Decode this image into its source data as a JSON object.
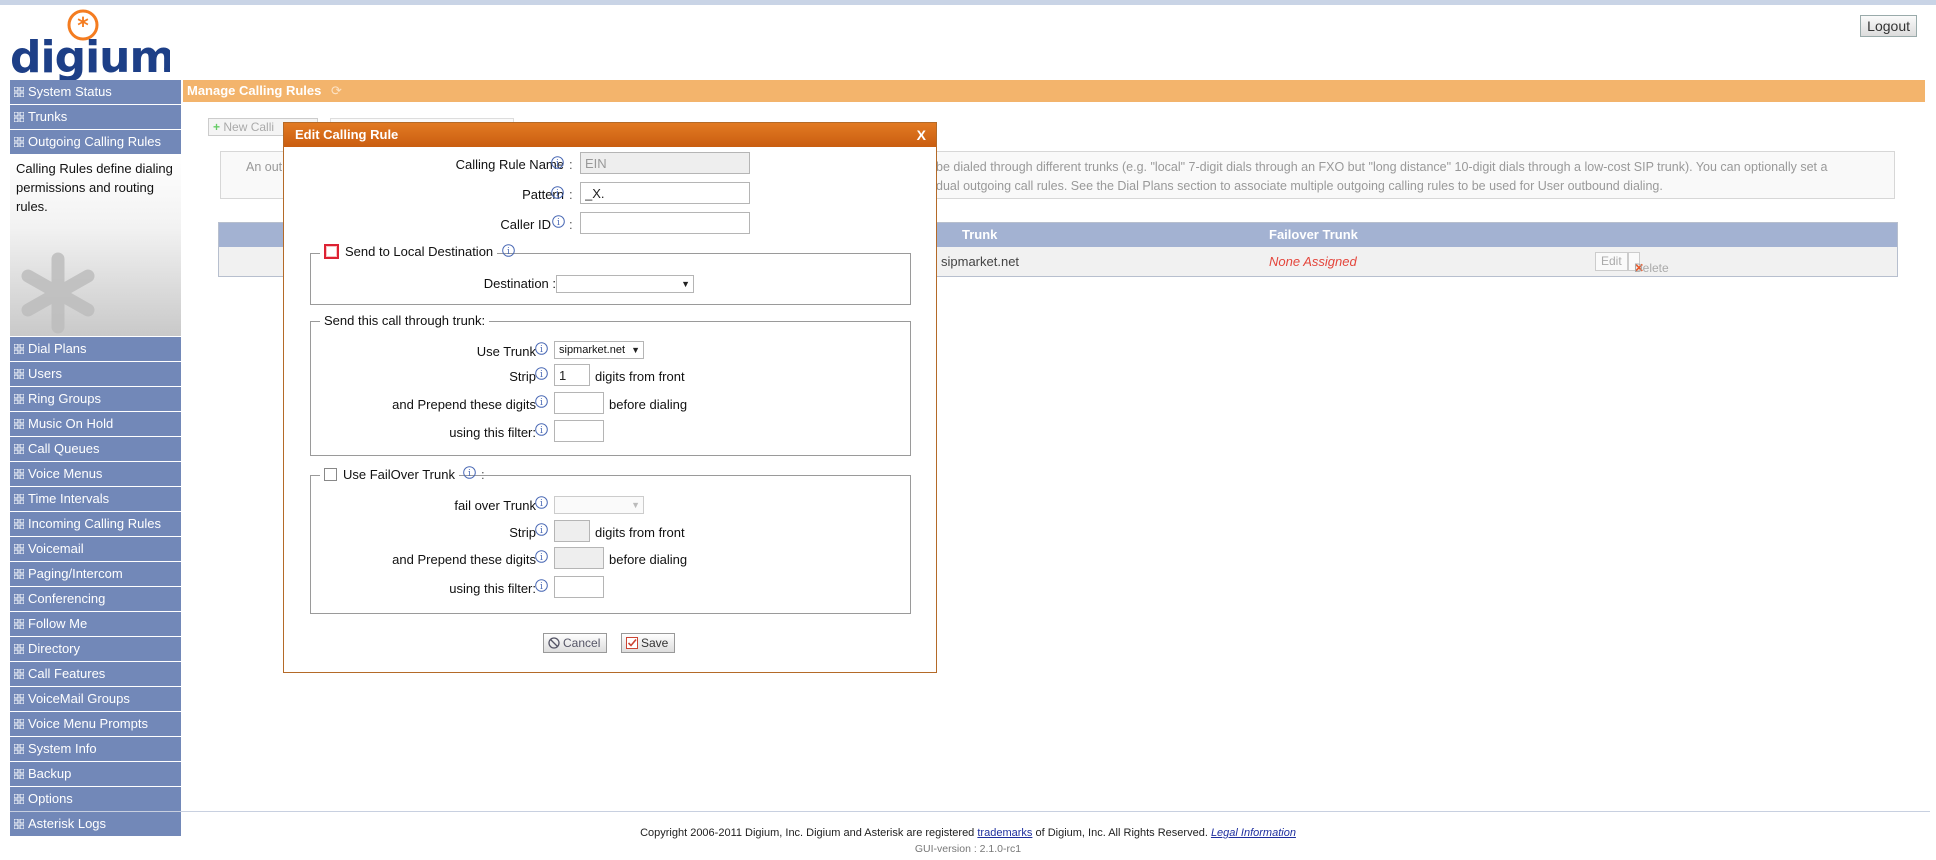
{
  "app": {
    "logo_text": "digium",
    "logout_label": "Logout"
  },
  "sidebar": {
    "items_top": [
      {
        "label": "System Status"
      },
      {
        "label": "Trunks"
      },
      {
        "label": "Outgoing Calling Rules"
      }
    ],
    "description": "Calling Rules define dialing permissions and routing rules.",
    "items_bottom": [
      {
        "label": "Dial Plans"
      },
      {
        "label": "Users"
      },
      {
        "label": "Ring Groups"
      },
      {
        "label": "Music On Hold"
      },
      {
        "label": "Call Queues"
      },
      {
        "label": "Voice Menus"
      },
      {
        "label": "Time Intervals"
      },
      {
        "label": "Incoming Calling Rules"
      },
      {
        "label": "Voicemail"
      },
      {
        "label": "Paging/Intercom"
      },
      {
        "label": "Conferencing"
      },
      {
        "label": "Follow Me"
      },
      {
        "label": "Directory"
      },
      {
        "label": "Call Features"
      },
      {
        "label": "VoiceMail Groups"
      },
      {
        "label": "Voice Menu Prompts"
      },
      {
        "label": "System Info"
      },
      {
        "label": "Backup"
      },
      {
        "label": "Options"
      },
      {
        "label": "Asterisk Logs"
      }
    ]
  },
  "main": {
    "title": "Manage Calling Rules",
    "new_button_label": "New Calli",
    "info_line1_left": "An out",
    "info_line1_right": "be dialed through different trunks (e.g. \"local\" 7-digit dials through an FXO but \"long distance\" 10-digit dials through a low-cost SIP trunk). You can optionally set a",
    "info_line2_right": "dual outgoing call rules. See the Dial Plans section to associate multiple outgoing calling rules to be used for User outbound dialing.",
    "table": {
      "col_trunk": "Trunk",
      "col_failover": "Failover Trunk",
      "row": {
        "trunk": "sipmarket.net",
        "failover": "None Assigned",
        "edit_label": "Edit",
        "delete_label": "Delete"
      }
    }
  },
  "dialog": {
    "title": "Edit Calling Rule",
    "close_label": "X",
    "calling_rule_name_label": "Calling Rule Name",
    "calling_rule_name_value": "EIN",
    "pattern_label": "Pattern",
    "pattern_value": "_X.",
    "caller_id_label": "Caller ID",
    "caller_id_value": "",
    "send_local_label": "Send to Local Destination",
    "send_local_checked": false,
    "destination_label": "Destination :",
    "destination_value": "",
    "trunk_section_legend": "Send this call through trunk:",
    "use_trunk_label": "Use Trunk",
    "use_trunk_value": "sipmarket.net",
    "strip_label": "Strip",
    "strip_value": "1",
    "digits_from_front": "digits from front",
    "prepend_label": "and Prepend these digits",
    "prepend_value": "",
    "before_dialing": "before dialing",
    "filter_label": "using this filter:",
    "filter_value": "",
    "failover_legend": "Use FailOver Trunk",
    "failover_checked": false,
    "failover_trunk_label": "fail over Trunk",
    "failover_trunk_value": "",
    "fo_strip_label": "Strip",
    "fo_strip_value": "",
    "fo_digits_from_front": "digits from front",
    "fo_prepend_label": "and Prepend these digits",
    "fo_prepend_value": "",
    "fo_before_dialing": "before dialing",
    "fo_filter_label": "using this filter:",
    "fo_filter_value": "",
    "cancel_label": "Cancel",
    "save_label": "Save"
  },
  "footer": {
    "copyright_prefix": "Copyright 2006-2011 Digium, Inc. Digium and Asterisk are registered",
    "trademarks_link": "trademarks",
    "copyright_middle": "of Digium, Inc. All Rights Reserved.",
    "legal_link": "Legal Information",
    "version": "GUI-version : 2.1.0-rc1"
  },
  "colors": {
    "sidebar_bg": "#7288b8",
    "header_bg": "#f3b46c",
    "dialog_title_bg": "#d96a18",
    "table_head_bg": "#a3b2d2",
    "error_text": "#e4463c"
  },
  "icons": [
    "grid-icon",
    "asterisk-icon",
    "info-icon",
    "plus-icon",
    "refresh-icon",
    "cancel-icon",
    "save-check-icon",
    "delete-x-icon",
    "close-icon"
  ]
}
